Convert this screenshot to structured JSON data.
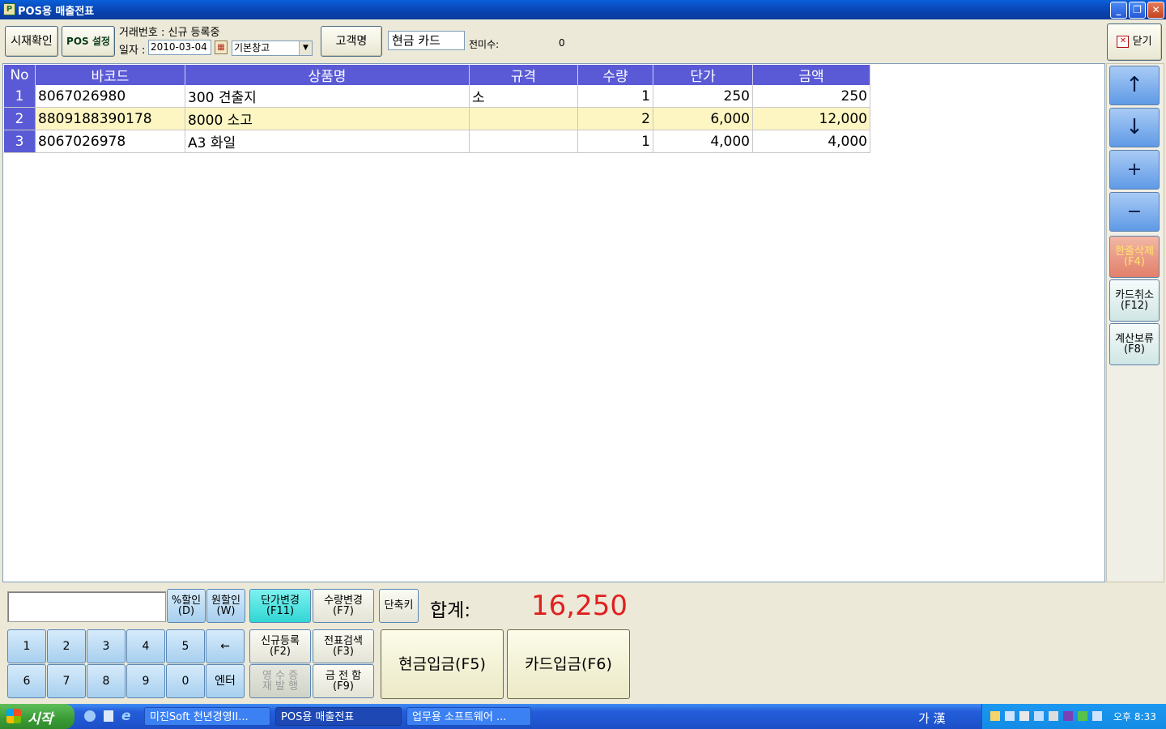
{
  "window": {
    "title": "POS용 매출전표"
  },
  "toolbar": {
    "btn_cash_check": "시재확인",
    "btn_pos_settings": "POS 설정",
    "deal_no_label": "거래번호 : 신규 등록중",
    "date_label": "일자 :",
    "date_value": "2010-03-04",
    "warehouse_value": "기본창고",
    "btn_customer": "고객명",
    "pay_type": "현금 카드",
    "prev_unpaid_label": "전미수:",
    "prev_unpaid_value": "0",
    "btn_close": "닫기"
  },
  "grid": {
    "headers": {
      "no": "No",
      "barcode": "바코드",
      "name": "상품명",
      "spec": "규격",
      "qty": "수량",
      "price": "단가",
      "amount": "금액"
    },
    "rows": [
      {
        "no": "1",
        "barcode": "8067026980",
        "name": "300 견출지",
        "spec": "소",
        "qty": "1",
        "price": "250",
        "amount": "250"
      },
      {
        "no": "2",
        "barcode": "8809188390178",
        "name": "8000 소고",
        "spec": "",
        "qty": "2",
        "price": "6,000",
        "amount": "12,000"
      },
      {
        "no": "3",
        "barcode": "8067026978",
        "name": "A3 화일",
        "spec": "",
        "qty": "1",
        "price": "4,000",
        "amount": "4,000"
      }
    ]
  },
  "right_panel": {
    "up": "↑",
    "down": "↓",
    "plus": "+",
    "minus": "−",
    "delete_line": "한줄삭제",
    "delete_line_key": "(F4)",
    "card_cancel": "카드취소",
    "card_cancel_key": "(F12)",
    "hold": "계산보류",
    "hold_key": "(F8)"
  },
  "bottom": {
    "pct_discount": "%할인",
    "pct_discount_key": "(D)",
    "won_discount": "원할인",
    "won_discount_key": "(W)",
    "price_change": "단가변경",
    "price_change_key": "(F11)",
    "qty_change": "수량변경",
    "qty_change_key": "(F7)",
    "shortcut": "단축키",
    "total_label": "합계:",
    "total_value": "16,250",
    "keypad": [
      "1",
      "2",
      "3",
      "4",
      "5",
      "←",
      "6",
      "7",
      "8",
      "9",
      "0",
      "엔터"
    ],
    "new_entry": "신규등록",
    "new_entry_key": "(F2)",
    "slip_search": "전표검색",
    "slip_search_key": "(F3)",
    "receipt_reissue_l1": "영 수 증",
    "receipt_reissue_l2": "재 발 행",
    "cash_drawer_l1": "금 전 함",
    "cash_drawer_key": "(F9)",
    "cash_deposit": "현금입금(F5)",
    "card_deposit": "카드입금(F6)"
  },
  "taskbar": {
    "start": "시작",
    "tasks": [
      "미진Soft 천년경영II...",
      "POS용 매출전표",
      "업무용 소프트웨어 ..."
    ],
    "ime": "가 漢",
    "clock": "오후 8:33"
  },
  "colors": {
    "grid_header": "#5a5ad6",
    "selected_row": "#fdf6c3",
    "total": "#e02020"
  }
}
